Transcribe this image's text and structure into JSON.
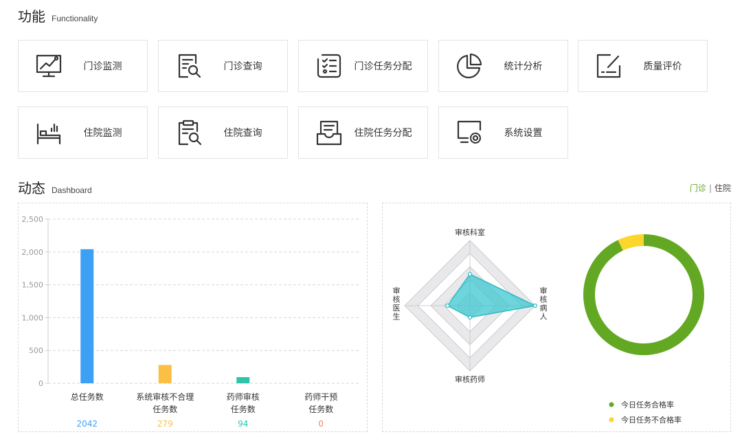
{
  "functionality": {
    "title": "功能",
    "subtitle": "Functionality",
    "tiles": [
      {
        "label": "门诊监测",
        "icon": "monitor-chart-icon"
      },
      {
        "label": "门诊查询",
        "icon": "document-search-icon"
      },
      {
        "label": "门诊任务分配",
        "icon": "task-checklist-icon"
      },
      {
        "label": "统计分析",
        "icon": "pie-chart-icon"
      },
      {
        "label": "质量评价",
        "icon": "edit-rating-icon"
      },
      {
        "label": "住院监测",
        "icon": "hospital-bed-icon"
      },
      {
        "label": "住院查询",
        "icon": "clipboard-search-icon"
      },
      {
        "label": "住院任务分配",
        "icon": "inbox-task-icon"
      },
      {
        "label": "系统设置",
        "icon": "settings-monitor-icon"
      }
    ]
  },
  "dashboard": {
    "title": "动态",
    "subtitle": "Dashboard",
    "switch": {
      "active": "门诊",
      "separator": "|",
      "inactive": "住院"
    }
  },
  "colors": {
    "bar_blue": "#3ca0f5",
    "bar_orange": "#fbbf46",
    "bar_teal": "#2fc4a8",
    "bar_red": "#f08a5d",
    "radar_fill": "#3cc7cf",
    "donut_green": "#63a822",
    "donut_yellow": "#fcd52d",
    "accent_green": "#5fa51c"
  },
  "chart_data": [
    {
      "type": "bar",
      "categories": [
        [
          "总任务数"
        ],
        [
          "系统审核不合理",
          "任务数"
        ],
        [
          "药师审核",
          "任务数"
        ],
        [
          "药师干预",
          "任务数"
        ]
      ],
      "values": [
        2042,
        279,
        94,
        0
      ],
      "value_labels": [
        "2042",
        "279",
        "94",
        "0"
      ],
      "value_colors": [
        "#3ca0f5",
        "#fbbf46",
        "#2fc4a8",
        "#f08a5d"
      ],
      "ylim": [
        0,
        2500
      ],
      "yticks": [
        0,
        500,
        1000,
        1500,
        2000,
        2500
      ],
      "ytick_labels": [
        "0",
        "500",
        "1,000",
        "1,500",
        "2,000",
        "2,500"
      ],
      "grid": true
    },
    {
      "type": "radar",
      "indicators": [
        "审核科室",
        "审核病人",
        "审核药师",
        "审核医生"
      ],
      "values": [
        0.37,
        1.0,
        0.0,
        0.2
      ],
      "max": 1.0
    },
    {
      "type": "pie",
      "style": "donut",
      "labels": [
        "今日任务合格率",
        "今日任务不合格率"
      ],
      "values": [
        93,
        7
      ],
      "colors": [
        "#63a822",
        "#fcd52d"
      ],
      "legend": "bottom-right"
    }
  ]
}
